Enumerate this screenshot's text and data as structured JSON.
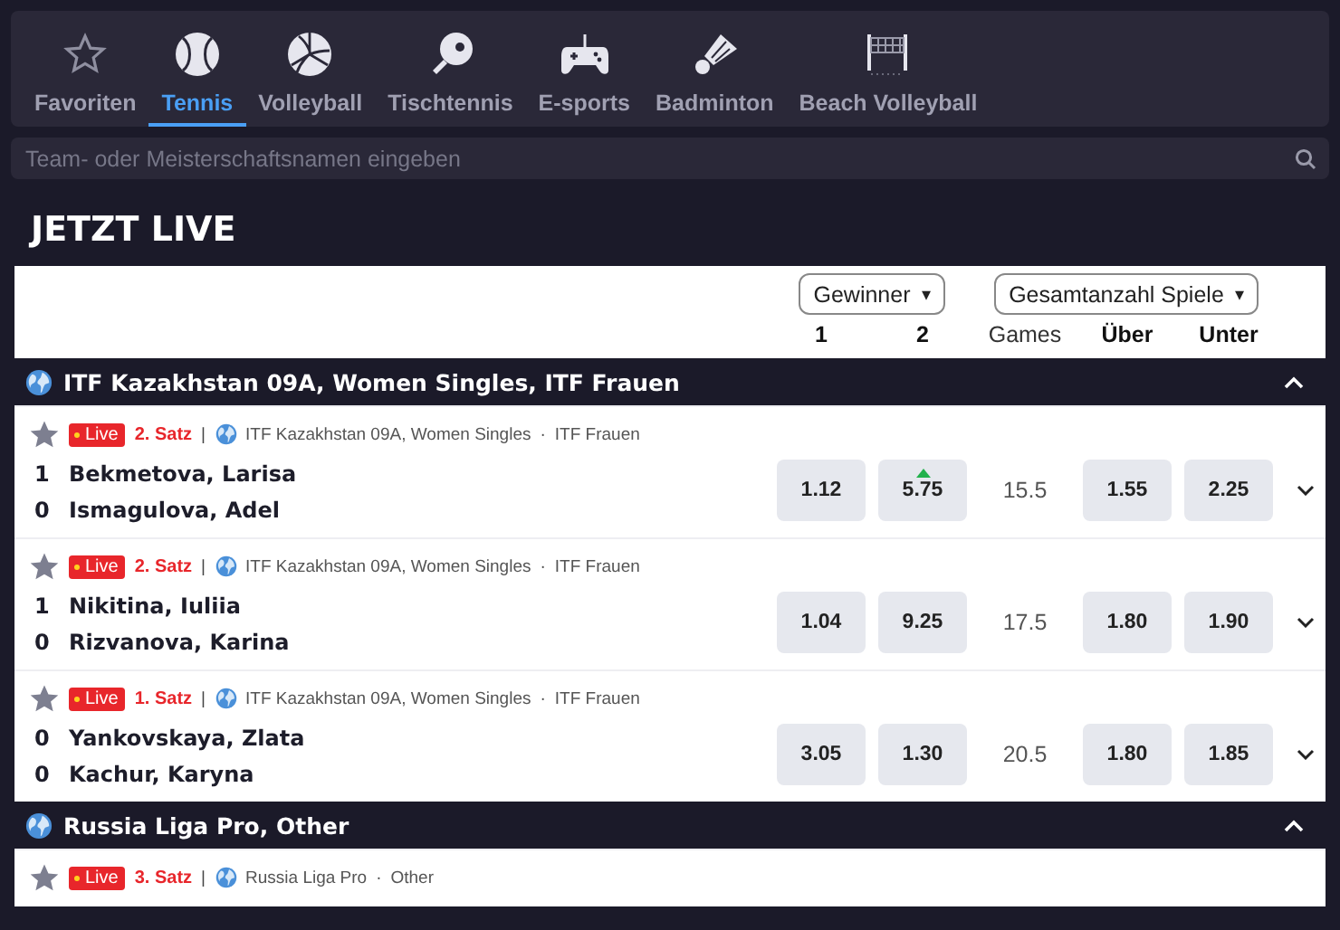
{
  "sports_tabs": [
    {
      "label": "Favoriten",
      "selected": false
    },
    {
      "label": "Tennis",
      "selected": true
    },
    {
      "label": "Volleyball",
      "selected": false
    },
    {
      "label": "Tischtennis",
      "selected": false
    },
    {
      "label": "E-sports",
      "selected": false
    },
    {
      "label": "Badminton",
      "selected": false
    },
    {
      "label": "Beach Volleyball",
      "selected": false
    }
  ],
  "search": {
    "placeholder": "Team- oder Meisterschaftsnamen eingeben"
  },
  "section_title": "JETZT LIVE",
  "market_header": {
    "dropdowns": [
      {
        "label": "Gewinner",
        "caret": "▾"
      },
      {
        "label": "Gesamtanzahl Spiele",
        "caret": "▾"
      }
    ],
    "columns": [
      {
        "label": "1",
        "kind": "outcome"
      },
      {
        "label": "2",
        "kind": "outcome"
      },
      {
        "label": "Games",
        "kind": "line"
      },
      {
        "label": "Über",
        "kind": "outcome"
      },
      {
        "label": "Unter",
        "kind": "outcome"
      }
    ]
  },
  "leagues": [
    {
      "name": "ITF Kazakhstan 09A, Women Singles, ITF Frauen",
      "expanded": true,
      "matches": [
        {
          "favorite": false,
          "badge": "Live",
          "period": "2. Satz",
          "separator": "|",
          "tournament": "ITF Kazakhstan 09A, Women Singles",
          "bullet": "·",
          "category": "ITF Frauen",
          "players": [
            {
              "score": "1",
              "name": "Bekmetova, Larisa"
            },
            {
              "score": "0",
              "name": "Ismagulova, Adel"
            }
          ],
          "odds_winner": [
            {
              "value": "1.12",
              "rising": false
            },
            {
              "value": "5.75",
              "rising": true
            }
          ],
          "games_line": "15.5",
          "odds_total": [
            {
              "value": "1.55",
              "rising": false
            },
            {
              "value": "2.25",
              "rising": false
            }
          ],
          "expanded": false
        },
        {
          "favorite": false,
          "badge": "Live",
          "period": "2. Satz",
          "separator": "|",
          "tournament": "ITF Kazakhstan 09A, Women Singles",
          "bullet": "·",
          "category": "ITF Frauen",
          "players": [
            {
              "score": "1",
              "name": "Nikitina, Iuliia"
            },
            {
              "score": "0",
              "name": "Rizvanova, Karina"
            }
          ],
          "odds_winner": [
            {
              "value": "1.04",
              "rising": false
            },
            {
              "value": "9.25",
              "rising": false
            }
          ],
          "games_line": "17.5",
          "odds_total": [
            {
              "value": "1.80",
              "rising": false
            },
            {
              "value": "1.90",
              "rising": false
            }
          ],
          "expanded": false
        },
        {
          "favorite": false,
          "badge": "Live",
          "period": "1. Satz",
          "separator": "|",
          "tournament": "ITF Kazakhstan 09A, Women Singles",
          "bullet": "·",
          "category": "ITF Frauen",
          "players": [
            {
              "score": "0",
              "name": "Yankovskaya, Zlata"
            },
            {
              "score": "0",
              "name": "Kachur, Karyna"
            }
          ],
          "odds_winner": [
            {
              "value": "3.05",
              "rising": false
            },
            {
              "value": "1.30",
              "rising": false
            }
          ],
          "games_line": "20.5",
          "odds_total": [
            {
              "value": "1.80",
              "rising": false
            },
            {
              "value": "1.85",
              "rising": false
            }
          ],
          "expanded": false
        }
      ]
    },
    {
      "name": "Russia Liga Pro, Other",
      "expanded": true,
      "matches": [
        {
          "favorite": false,
          "badge": "Live",
          "period": "3. Satz",
          "separator": "|",
          "tournament": "Russia Liga Pro",
          "bullet": "·",
          "category": "Other"
        }
      ]
    }
  ]
}
